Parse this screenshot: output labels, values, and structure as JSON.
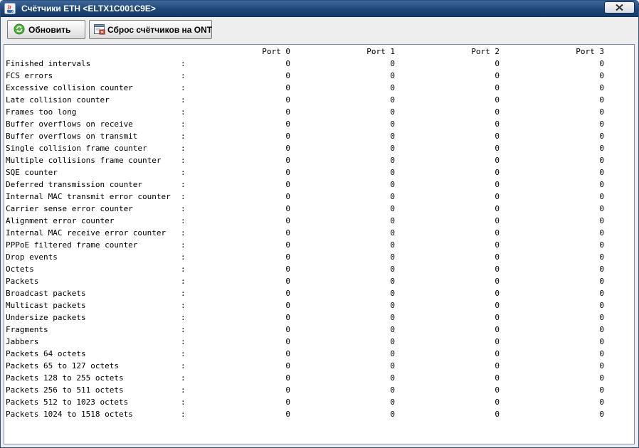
{
  "window": {
    "title": "Счётчики ETH <ELTX1C001C9E>"
  },
  "toolbar": {
    "refresh_label": "Обновить",
    "reset_label": "Сброс счётчиков на ONT"
  },
  "table": {
    "headers": [
      "Port 0",
      "Port 1",
      "Port 2",
      "Port 3"
    ],
    "separator": ":",
    "rows": [
      {
        "name": "Finished intervals",
        "values": [
          "0",
          "0",
          "0",
          "0"
        ]
      },
      {
        "name": "FCS errors",
        "values": [
          "0",
          "0",
          "0",
          "0"
        ]
      },
      {
        "name": "Excessive collision counter",
        "values": [
          "0",
          "0",
          "0",
          "0"
        ]
      },
      {
        "name": "Late collision counter",
        "values": [
          "0",
          "0",
          "0",
          "0"
        ]
      },
      {
        "name": "Frames too long",
        "values": [
          "0",
          "0",
          "0",
          "0"
        ]
      },
      {
        "name": "Buffer overflows on receive",
        "values": [
          "0",
          "0",
          "0",
          "0"
        ]
      },
      {
        "name": "Buffer overflows on transmit",
        "values": [
          "0",
          "0",
          "0",
          "0"
        ]
      },
      {
        "name": "Single collision frame counter",
        "values": [
          "0",
          "0",
          "0",
          "0"
        ]
      },
      {
        "name": "Multiple collisions frame counter",
        "values": [
          "0",
          "0",
          "0",
          "0"
        ]
      },
      {
        "name": "SQE counter",
        "values": [
          "0",
          "0",
          "0",
          "0"
        ]
      },
      {
        "name": "Deferred transmission counter",
        "values": [
          "0",
          "0",
          "0",
          "0"
        ]
      },
      {
        "name": "Internal MAC transmit error counter",
        "values": [
          "0",
          "0",
          "0",
          "0"
        ]
      },
      {
        "name": "Carrier sense error counter",
        "values": [
          "0",
          "0",
          "0",
          "0"
        ]
      },
      {
        "name": "Alignment error counter",
        "values": [
          "0",
          "0",
          "0",
          "0"
        ]
      },
      {
        "name": "Internal MAC receive error counter",
        "values": [
          "0",
          "0",
          "0",
          "0"
        ]
      },
      {
        "name": "PPPoE filtered frame counter",
        "values": [
          "0",
          "0",
          "0",
          "0"
        ]
      },
      {
        "name": "Drop events",
        "values": [
          "0",
          "0",
          "0",
          "0"
        ]
      },
      {
        "name": "Octets",
        "values": [
          "0",
          "0",
          "0",
          "0"
        ]
      },
      {
        "name": "Packets",
        "values": [
          "0",
          "0",
          "0",
          "0"
        ]
      },
      {
        "name": "Broadcast packets",
        "values": [
          "0",
          "0",
          "0",
          "0"
        ]
      },
      {
        "name": "Multicast packets",
        "values": [
          "0",
          "0",
          "0",
          "0"
        ]
      },
      {
        "name": "Undersize packets",
        "values": [
          "0",
          "0",
          "0",
          "0"
        ]
      },
      {
        "name": "Fragments",
        "values": [
          "0",
          "0",
          "0",
          "0"
        ]
      },
      {
        "name": "Jabbers",
        "values": [
          "0",
          "0",
          "0",
          "0"
        ]
      },
      {
        "name": "Packets 64 octets",
        "values": [
          "0",
          "0",
          "0",
          "0"
        ]
      },
      {
        "name": "Packets 65 to 127 octets",
        "values": [
          "0",
          "0",
          "0",
          "0"
        ]
      },
      {
        "name": "Packets 128 to 255 octets",
        "values": [
          "0",
          "0",
          "0",
          "0"
        ]
      },
      {
        "name": "Packets 256 to 511 octets",
        "values": [
          "0",
          "0",
          "0",
          "0"
        ]
      },
      {
        "name": "Packets 512 to 1023 octets",
        "values": [
          "0",
          "0",
          "0",
          "0"
        ]
      },
      {
        "name": "Packets 1024 to 1518 octets",
        "values": [
          "0",
          "0",
          "0",
          "0"
        ]
      }
    ]
  },
  "icons": {
    "app": "java-cup-icon",
    "close": "close-icon",
    "refresh": "refresh-icon",
    "reset": "reset-counters-icon"
  },
  "colors": {
    "titlebar": "#1f4677",
    "refresh_icon": "#3a9a2a",
    "reset_icon": "#c0392b"
  }
}
